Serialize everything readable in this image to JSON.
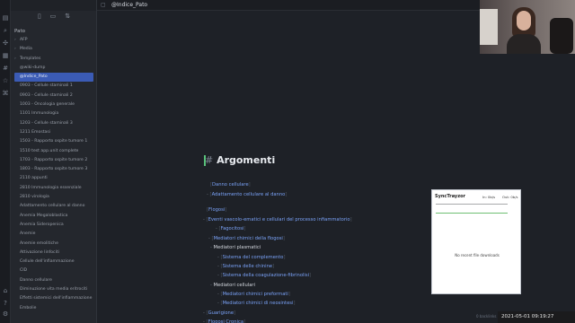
{
  "tab": {
    "title": "@Indice_Pato"
  },
  "sidebar": {
    "vault_name": "Pato",
    "items": [
      {
        "label": "AFP",
        "folder": true,
        "active": false
      },
      {
        "label": "Media",
        "folder": true,
        "active": false
      },
      {
        "label": "Templates",
        "folder": true,
        "active": false
      },
      {
        "label": "@wiki-dump",
        "folder": false,
        "active": false
      },
      {
        "label": "@Indice_Pato",
        "folder": false,
        "active": true
      },
      {
        "label": "0903 - Cellule staminali 1",
        "folder": false,
        "active": false
      },
      {
        "label": "0903 - Cellule staminali 2",
        "folder": false,
        "active": false
      },
      {
        "label": "1003 - Oncologia generale",
        "folder": false,
        "active": false
      },
      {
        "label": "1101 Immunologia",
        "folder": false,
        "active": false
      },
      {
        "label": "1203 - Cellule staminali 3",
        "folder": false,
        "active": false
      },
      {
        "label": "1211 Emostasi",
        "folder": false,
        "active": false
      },
      {
        "label": "1503 - Rapporto ospite tumore 1",
        "folder": false,
        "active": false
      },
      {
        "label": "1510 test app.unit complete",
        "folder": false,
        "active": false
      },
      {
        "label": "1703 - Rapporto ospite tumore 2",
        "folder": false,
        "active": false
      },
      {
        "label": "1803 - Rapporto ospite tumore 3",
        "folder": false,
        "active": false
      },
      {
        "label": "2110 appunti",
        "folder": false,
        "active": false
      },
      {
        "label": "2810 Immunologia essenziale",
        "folder": false,
        "active": false
      },
      {
        "label": "2810 virologia",
        "folder": false,
        "active": false
      },
      {
        "label": "Adattamento cellulare al danno",
        "folder": false,
        "active": false
      },
      {
        "label": "Anemia Megaloblastica",
        "folder": false,
        "active": false
      },
      {
        "label": "Anemia Sideropenica",
        "folder": false,
        "active": false
      },
      {
        "label": "Anemie",
        "folder": false,
        "active": false
      },
      {
        "label": "Anemie emolitiche",
        "folder": false,
        "active": false
      },
      {
        "label": "Attivazione linfociti",
        "folder": false,
        "active": false
      },
      {
        "label": "Cellule dell'infiammazione",
        "folder": false,
        "active": false
      },
      {
        "label": "CID",
        "folder": false,
        "active": false
      },
      {
        "label": "Danno cellulare",
        "folder": false,
        "active": false
      },
      {
        "label": "Diminuzione vita media eritrociti",
        "folder": false,
        "active": false
      },
      {
        "label": "Effetti sistemici dell'infiammazione",
        "folder": false,
        "active": false
      },
      {
        "label": "Embolie",
        "folder": false,
        "active": false
      }
    ]
  },
  "document": {
    "heading_hash": "#",
    "heading": "Argomenti",
    "lines": [
      {
        "dash": "",
        "text": "Danno cellulare",
        "link": true
      },
      {
        "dash": "-",
        "text": "Adattamento cellulare al danno",
        "link": true
      },
      {
        "dash": "",
        "text": "Flogosi",
        "link": true
      },
      {
        "dash": "-",
        "text": "Eventi vascolo-ematici e cellulari del processo infiammatorio",
        "link": true
      },
      {
        "dash": "-",
        "text": "Fagocitosi",
        "link": true
      },
      {
        "dash": "-",
        "text": "Mediatori chimici della flogosi",
        "link": true
      },
      {
        "dash": "-",
        "text": "Mediatori plasmatici",
        "link": false
      },
      {
        "dash": "-",
        "text": "Sistema del complemento",
        "link": true
      },
      {
        "dash": "-",
        "text": "Sistema delle chinine",
        "link": true
      },
      {
        "dash": "-",
        "text": "Sistema della coagulazione-fibrinolisi",
        "link": true
      },
      {
        "dash": "-",
        "text": "Mediatori cellulari",
        "link": false
      },
      {
        "dash": "-",
        "text": "Mediatori chimici preformati",
        "link": true
      },
      {
        "dash": "-",
        "text": "Mediatori chimici di neosintesi",
        "link": true
      },
      {
        "dash": "-",
        "text": "Guarigione",
        "link": true
      },
      {
        "dash": "-",
        "text": "Flogosi Cronica",
        "link": true
      }
    ]
  },
  "popup": {
    "title": "SyncTrayzor",
    "in_label": "In: 0b/s",
    "out_label": "Out: 0b/s",
    "empty_text": "No recent file downloads"
  },
  "status": {
    "backlinks": "0 backlinks"
  },
  "clock": {
    "text": "2021-05-01  09:19:27"
  },
  "colors": {
    "accent": "#3b5bb5",
    "link": "#7aa2f7",
    "cursor": "#58c07a"
  }
}
